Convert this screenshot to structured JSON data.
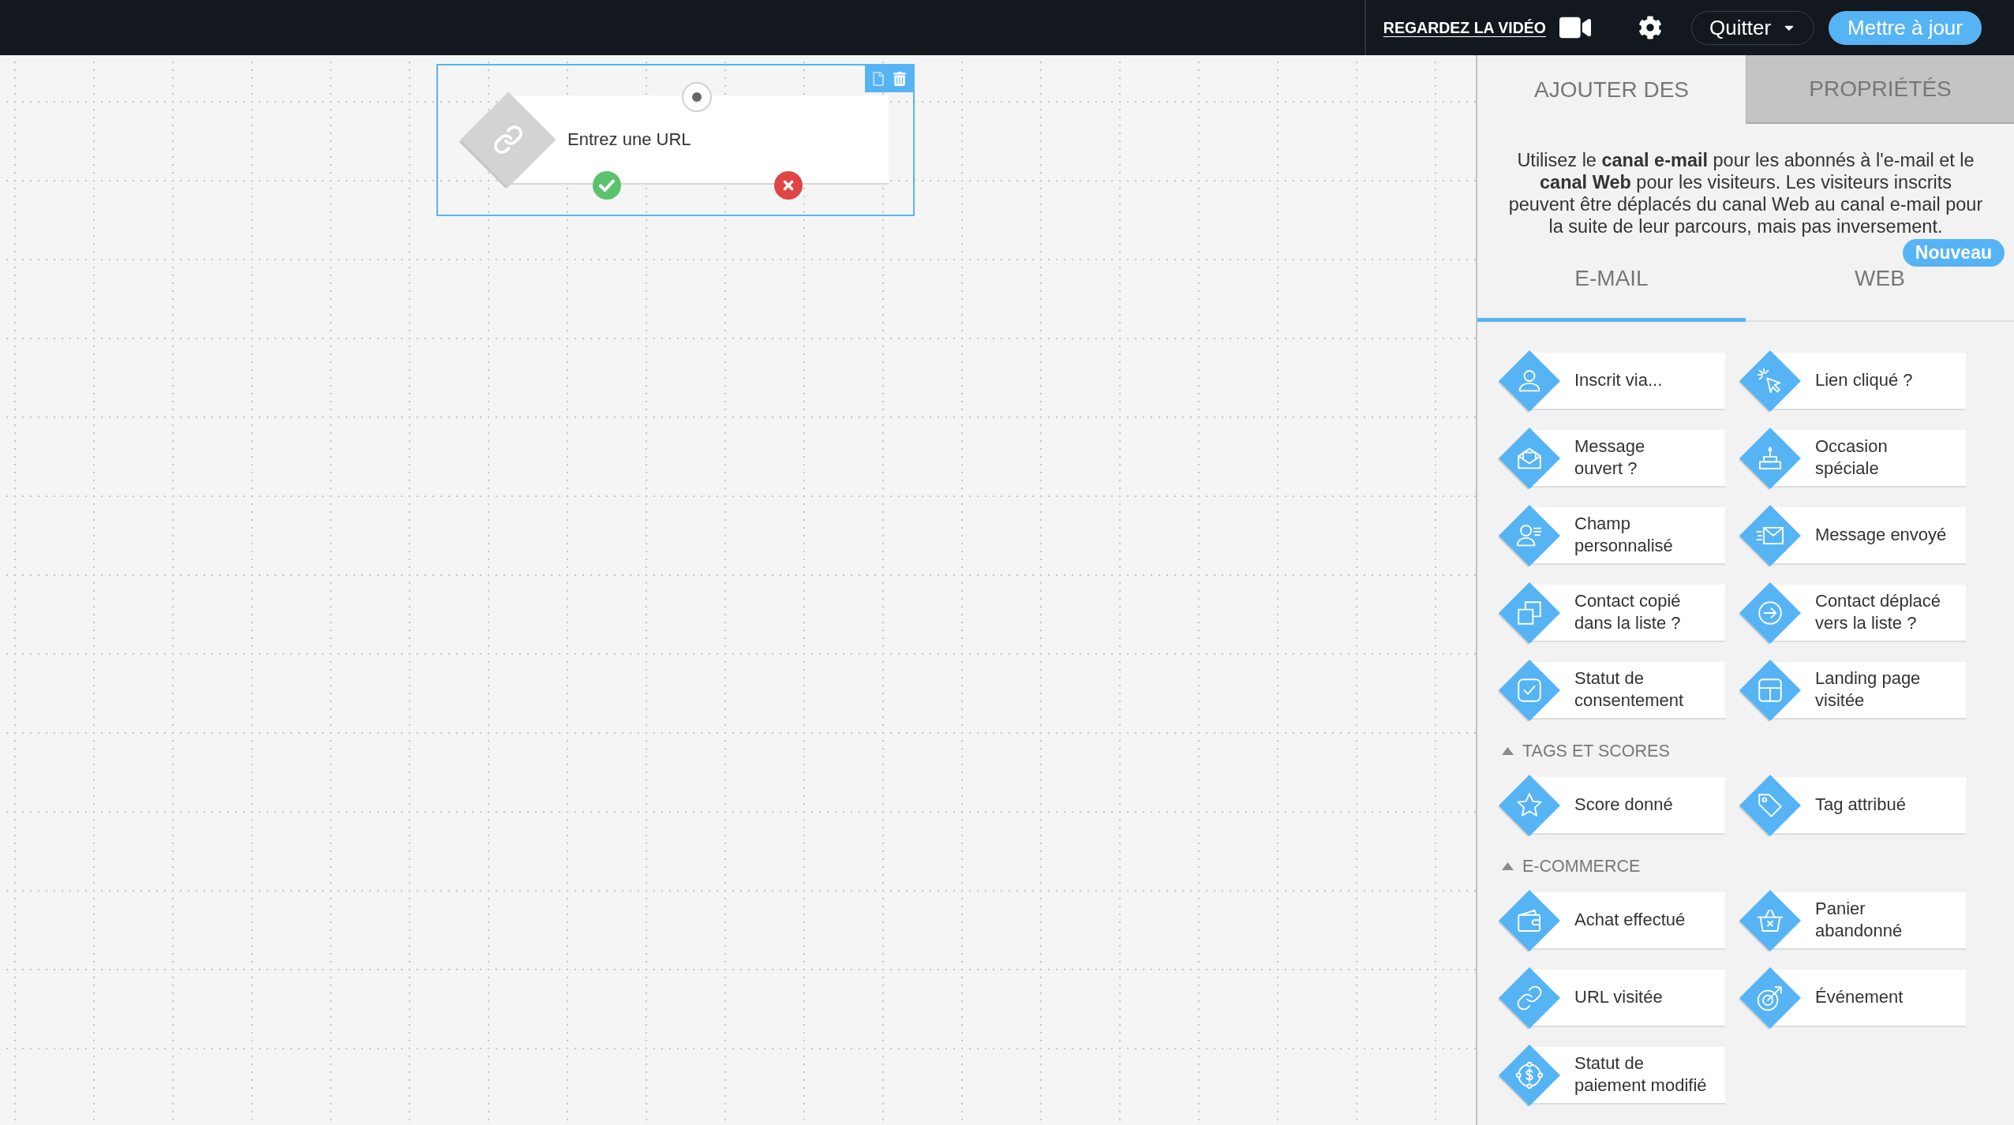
{
  "top_bar": {
    "video_link": "REGARDEZ LA VIDÉO",
    "quit_button": "Quitter",
    "update_button": "Mettre à jour"
  },
  "canvas": {
    "node": {
      "label": "Entrez une URL",
      "selected": true
    }
  },
  "panel": {
    "tabs": [
      {
        "label": "AJOUTER DES",
        "selected": true
      },
      {
        "label": "PROPRIÉTÉS",
        "selected": false
      }
    ],
    "intro": "Utilisez le **canal e-mail** pour les abonnés à l'e-mail et le **canal Web** pour les visiteurs. Les visiteurs inscrits peuvent être déplacés du canal Web au canal e-mail pour la suite de leur parcours, mais pas inversement.",
    "channel_tabs": [
      {
        "label": "E-MAIL",
        "selected": true
      },
      {
        "label": "WEB",
        "selected": false,
        "badge": "Nouveau"
      }
    ],
    "groups": [
      {
        "items": [
          "Inscrit via...",
          "Message ouvert ?",
          "Champ personnalisé",
          "Contact copié dans la liste ?",
          "Statut de consentement",
          "Lien cliqué ?",
          "Occasion spéciale",
          "Message envoyé",
          "Contact déplacé vers la liste ?",
          "Landing page visitée"
        ]
      },
      {
        "title": "TAGS ET SCORES",
        "expanded": true,
        "items": [
          "Score donné",
          "Tag attribué"
        ]
      },
      {
        "title": "E-COMMERCE",
        "expanded": true,
        "items": [
          "Achat effectué",
          "URL visitée",
          "Statut de paiement modifié",
          "Panier abandonné",
          "Événement"
        ]
      }
    ]
  }
}
